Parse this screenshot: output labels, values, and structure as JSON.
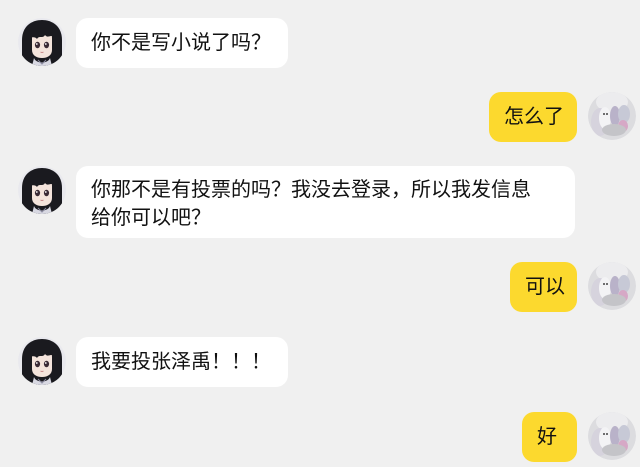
{
  "conversation": {
    "colors": {
      "background": "#f0f0f0",
      "incoming_bubble": "#ffffff",
      "outgoing_bubble": "#fcd92e"
    },
    "messages": [
      {
        "sender": "other",
        "avatar": "anime-girl-avatar-icon",
        "text": "你不是写小说了吗？"
      },
      {
        "sender": "self",
        "avatar": "plush-toy-avatar-icon",
        "text": "怎么了"
      },
      {
        "sender": "other",
        "avatar": "anime-girl-avatar-icon",
        "lines": [
          "你那不是有投票的吗？我没去登录，所以我发信息",
          "给你可以吧？"
        ]
      },
      {
        "sender": "self",
        "avatar": "plush-toy-avatar-icon",
        "text": "可以"
      },
      {
        "sender": "other",
        "avatar": "anime-girl-avatar-icon",
        "text": "我要投张泽禹！！！"
      },
      {
        "sender": "self",
        "avatar": "plush-toy-avatar-icon",
        "text": "好"
      }
    ]
  }
}
